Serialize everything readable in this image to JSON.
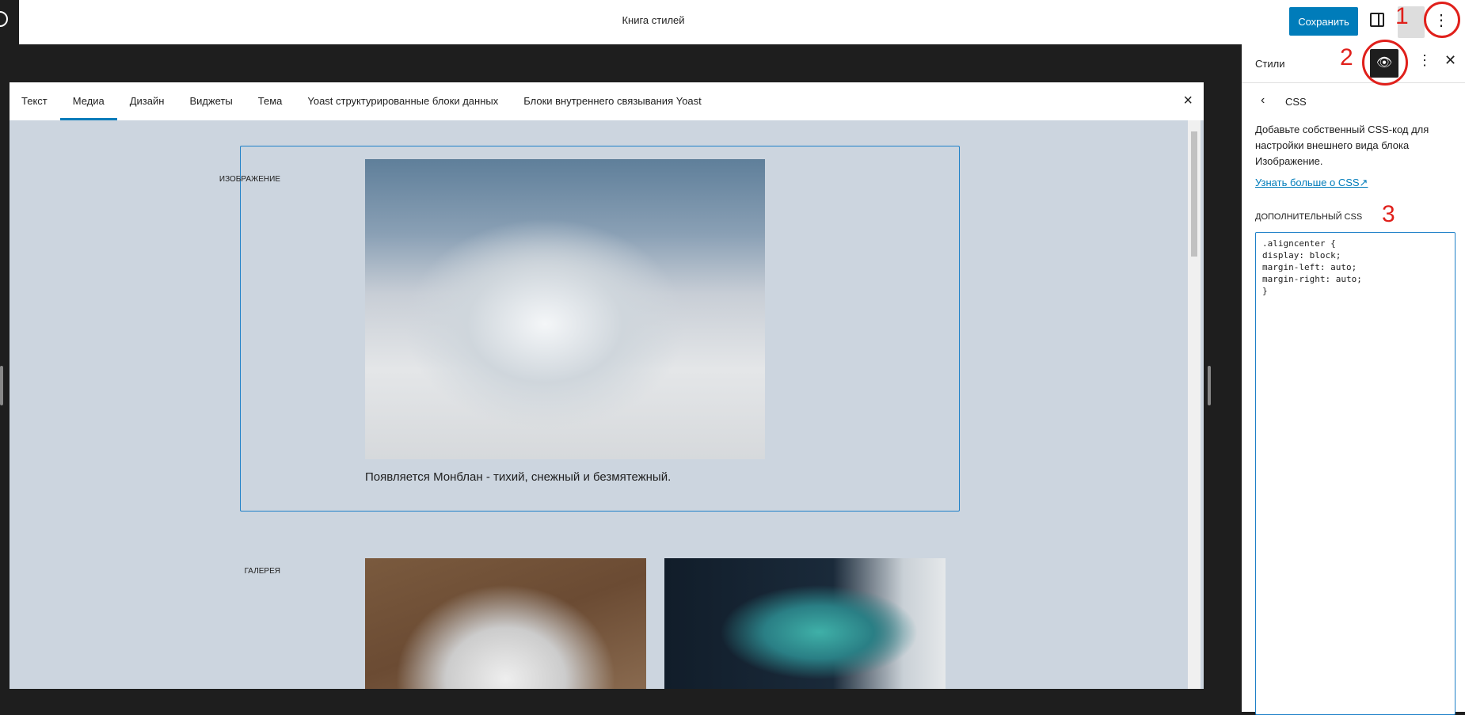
{
  "header": {
    "title": "Книга стилей",
    "save_label": "Сохранить"
  },
  "modal": {
    "tabs": [
      "Текст",
      "Медиа",
      "Дизайн",
      "Виджеты",
      "Тема",
      "Yoast структурированные блоки данных",
      "Блоки внутреннего связывания Yoast"
    ],
    "active_tab": "Медиа",
    "close_icon": "×"
  },
  "content": {
    "image_label": "Изображение",
    "caption": "Появляется Монблан - тихий, снежный и безмятежный.",
    "gallery_label": "Галерея"
  },
  "sidebar": {
    "title": "Стили",
    "section": "CSS",
    "description": "Добавьте собственный CSS-код для настройки внешнего вида блока Изображение.",
    "link": "Узнать больше о CSS",
    "link_icon": "↗",
    "css_label": "Дополнительный CSS",
    "css_value": ".aligncenter {\ndisplay: block;\nmargin-left: auto;\nmargin-right: auto;\n}"
  },
  "annotations": {
    "one": "1",
    "two": "2",
    "three": "3"
  },
  "colors": {
    "accent": "#007cba",
    "annotation": "#e0201b",
    "canvas_bg": "#ccd5df"
  }
}
